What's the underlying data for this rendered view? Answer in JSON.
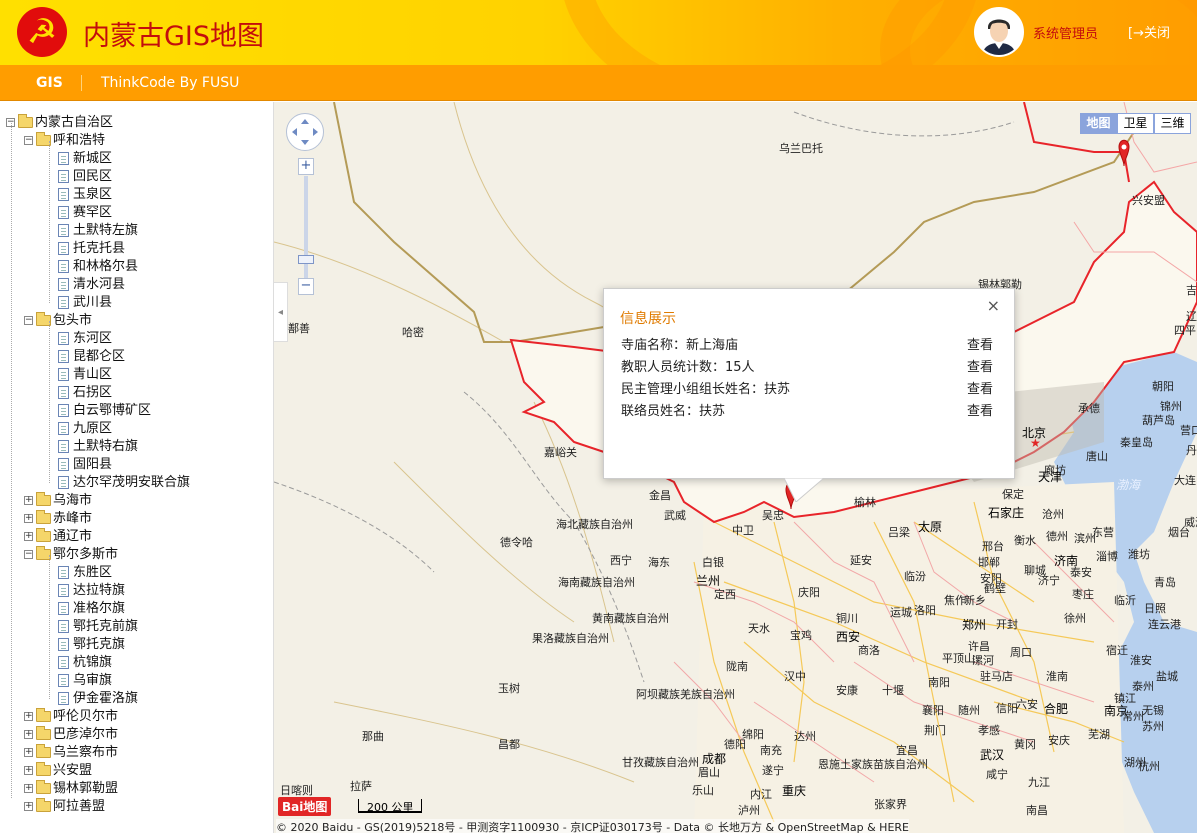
{
  "app": {
    "title": "内蒙古GIS地图",
    "logo_glyph": "☭"
  },
  "user": {
    "name": "系统管理员",
    "logout_label": "关闭",
    "logout_icon": "logout-icon"
  },
  "nav": {
    "items": [
      "GIS",
      "ThinkCode By FUSU"
    ]
  },
  "tree": {
    "root": "内蒙古自治区",
    "nodes": [
      {
        "label": "呼和浩特",
        "expanded": true,
        "children": [
          "新城区",
          "回民区",
          "玉泉区",
          "赛罕区",
          "土默特左旗",
          "托克托县",
          "和林格尔县",
          "清水河县",
          "武川县"
        ]
      },
      {
        "label": "包头市",
        "expanded": true,
        "children": [
          "东河区",
          "昆都仑区",
          "青山区",
          "石拐区",
          "白云鄂博矿区",
          "九原区",
          "土默特右旗",
          "固阳县",
          "达尔罕茂明安联合旗"
        ]
      },
      {
        "label": "乌海市",
        "expanded": false,
        "children": []
      },
      {
        "label": "赤峰市",
        "expanded": false,
        "children": []
      },
      {
        "label": "通辽市",
        "expanded": false,
        "children": []
      },
      {
        "label": "鄂尔多斯市",
        "expanded": true,
        "children": [
          "东胜区",
          "达拉特旗",
          "准格尔旗",
          "鄂托克前旗",
          "鄂托克旗",
          "杭锦旗",
          "乌审旗",
          "伊金霍洛旗"
        ]
      },
      {
        "label": "呼伦贝尔市",
        "expanded": false,
        "children": []
      },
      {
        "label": "巴彦淖尔市",
        "expanded": false,
        "children": []
      },
      {
        "label": "乌兰察布市",
        "expanded": false,
        "children": []
      },
      {
        "label": "兴安盟",
        "expanded": false,
        "children": []
      },
      {
        "label": "锡林郭勒盟",
        "expanded": false,
        "children": []
      },
      {
        "label": "阿拉善盟",
        "expanded": false,
        "children": []
      }
    ]
  },
  "map": {
    "types": [
      "地图",
      "卫星",
      "三维"
    ],
    "active_type": "地图",
    "zoom_plus": "+",
    "zoom_minus": "−",
    "scale": "200 公里",
    "brand": "Bai地图",
    "copyright": "© 2020 Baidu - GS(2019)5218号 - 甲测资字1100930 - 京ICP证030173号 - Data © 长地万方 & OpenStreetMap & HERE",
    "labels": [
      "乌兰巴托",
      "兴安盟",
      "锡林郭勒",
      "哈密",
      "鄯善",
      "嘉峪关",
      "金昌",
      "武威",
      "中卫",
      "吴忠",
      "海北藏族自治州",
      "德令哈",
      "西宁",
      "海东",
      "白银",
      "兰州",
      "定西",
      "海南藏族自治州",
      "黄南藏族自治州",
      "果洛藏族自治州",
      "天水",
      "宝鸡",
      "庆阳",
      "铜川",
      "延安",
      "临汾",
      "运城",
      "西安",
      "商洛",
      "陇南",
      "汉中",
      "安康",
      "十堰",
      "襄阳",
      "阿坝藏族羌族自治州",
      "玉树",
      "那曲",
      "昌都",
      "德阳",
      "绵阳",
      "南充",
      "达州",
      "成都",
      "眉山",
      "遂宁",
      "甘孜藏族自治州",
      "恩施土家族苗族自治州",
      "宜昌",
      "荆门",
      "乐山",
      "内江",
      "重庆",
      "泸州",
      "张家界",
      "拉萨",
      "日喀则",
      "榆林",
      "吕梁",
      "太原",
      "石家庄",
      "邢台",
      "邯郸",
      "安阳",
      "鹤壁",
      "新乡",
      "焦作",
      "洛阳",
      "郑州",
      "开封",
      "许昌",
      "平顶山",
      "漯河",
      "南阳",
      "驻马店",
      "周口",
      "信阳",
      "随州",
      "孝感",
      "武汉",
      "黄冈",
      "咸宁",
      "九江",
      "南昌",
      "合肥",
      "六安",
      "淮南",
      "安庆",
      "南京",
      "芜湖",
      "湖州",
      "杭州",
      "苏州",
      "无锡",
      "常州",
      "镇江",
      "盐城",
      "泰州",
      "淮安",
      "宿迁",
      "徐州",
      "连云港",
      "临沂",
      "枣庄",
      "济宁",
      "泰安",
      "济南",
      "淄博",
      "潍坊",
      "青岛",
      "日照",
      "烟台",
      "威海",
      "东营",
      "滨州",
      "德州",
      "聊城",
      "衡水",
      "沧州",
      "保定",
      "廊坊",
      "天津",
      "北京",
      "承德",
      "唐山",
      "秦皇岛",
      "锦州",
      "朝阳",
      "葫芦岛",
      "营口",
      "大连",
      "丹东",
      "辽源",
      "四平",
      "吉林"
    ],
    "seas": [
      "渤海"
    ]
  },
  "popup": {
    "title": "信息展示",
    "close": "×",
    "rows": [
      {
        "label": "寺庙名称：新上海庙",
        "action": "查看"
      },
      {
        "label": "教职人员统计数：15人",
        "action": "查看"
      },
      {
        "label": "民主管理小组组长姓名：扶苏",
        "action": "查看"
      },
      {
        "label": "联络员姓名：扶苏",
        "action": "查看"
      }
    ]
  },
  "colors": {
    "header_start": "#ffe000",
    "header_end": "#ff9d00",
    "title": "#c30d0d",
    "popup_title": "#e07b00",
    "border": "#e8242a"
  }
}
